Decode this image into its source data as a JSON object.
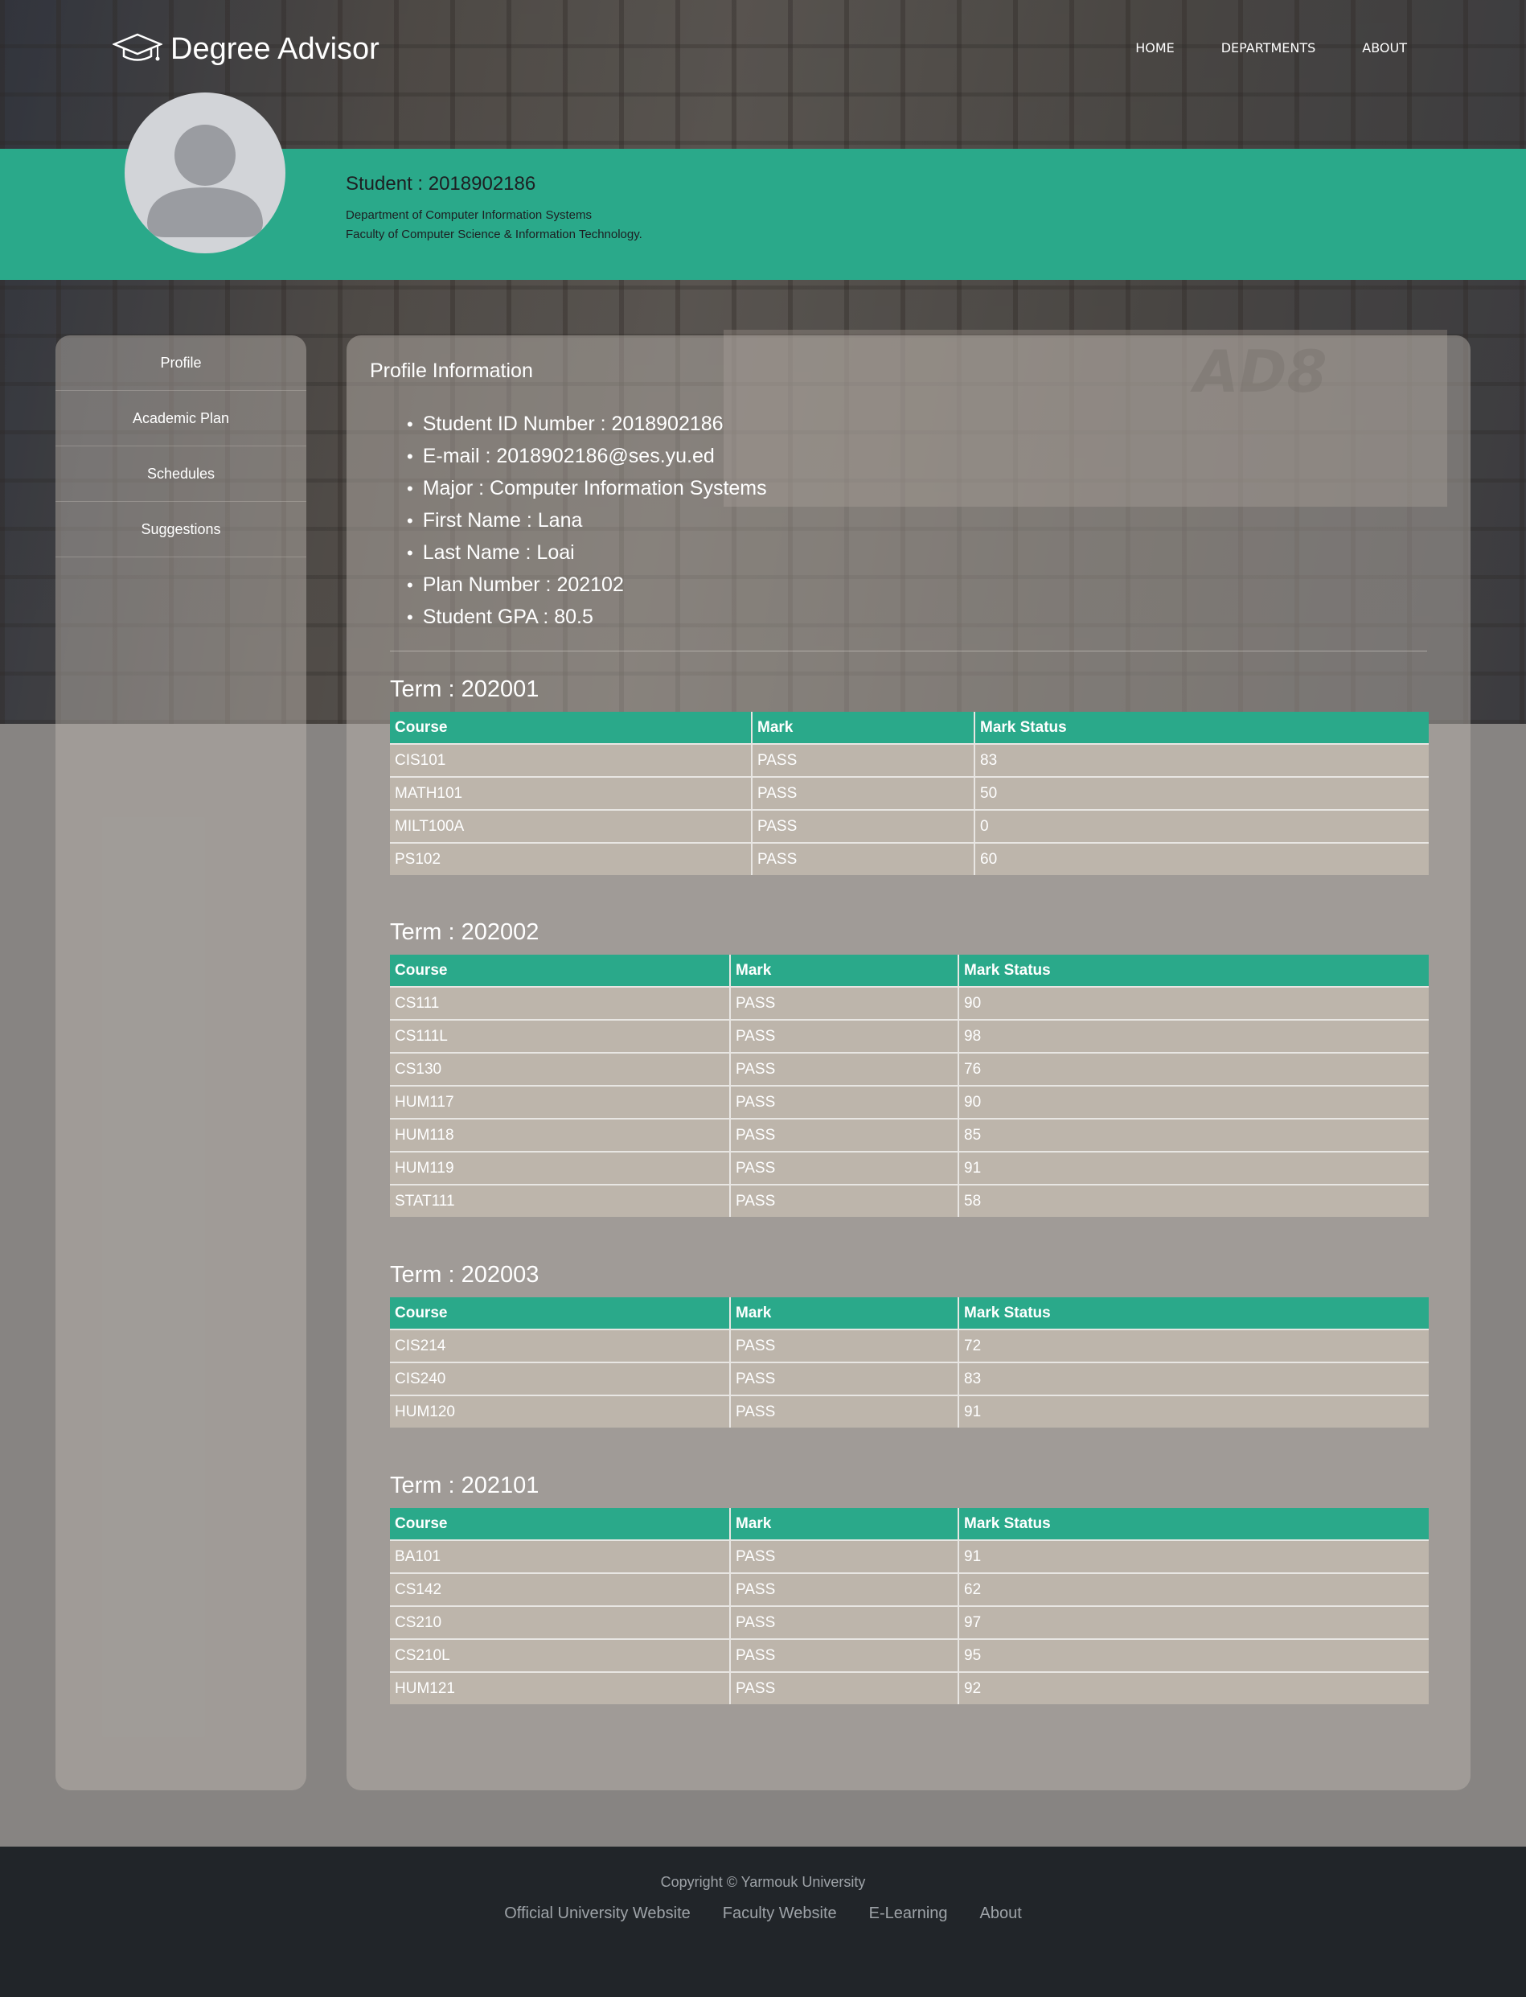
{
  "nav": {
    "brand": "Degree Advisor",
    "brand_icon": "graduation-cap-icon",
    "links": [
      "HOME",
      "DEPARTMENTS",
      "ABOUT"
    ]
  },
  "student": {
    "title": "Student : 2018902186",
    "department": "Department of Computer Information Systems",
    "faculty": "Faculty of Computer Science & Information Technology."
  },
  "sidebar": {
    "items": [
      "Profile",
      "Academic Plan",
      "Schedules",
      "Suggestions"
    ]
  },
  "profile": {
    "heading": "Profile Information",
    "items": [
      "Student ID Number : 2018902186",
      "E-mail : 2018902186@ses.yu.ed",
      "Major : Computer Information Systems",
      "First Name : Lana",
      "Last Name : Loai",
      "Plan Number : 202102",
      "Student GPA : 80.5"
    ]
  },
  "table_headers": [
    "Course",
    "Mark",
    "Mark Status"
  ],
  "terms": [
    {
      "title": "Term : 202001",
      "rows": [
        [
          "CIS101",
          "PASS",
          "83"
        ],
        [
          "MATH101",
          "PASS",
          "50"
        ],
        [
          "MILT100A",
          "PASS",
          "0"
        ],
        [
          "PS102",
          "PASS",
          "60"
        ]
      ]
    },
    {
      "title": "Term : 202002",
      "rows": [
        [
          "CS111",
          "PASS",
          "90"
        ],
        [
          "CS111L",
          "PASS",
          "98"
        ],
        [
          "CS130",
          "PASS",
          "76"
        ],
        [
          "HUM117",
          "PASS",
          "90"
        ],
        [
          "HUM118",
          "PASS",
          "85"
        ],
        [
          "HUM119",
          "PASS",
          "91"
        ],
        [
          "STAT111",
          "PASS",
          "58"
        ]
      ]
    },
    {
      "title": "Term : 202003",
      "rows": [
        [
          "CIS214",
          "PASS",
          "72"
        ],
        [
          "CIS240",
          "PASS",
          "83"
        ],
        [
          "HUM120",
          "PASS",
          "91"
        ]
      ]
    },
    {
      "title": "Term : 202101",
      "rows": [
        [
          "BA101",
          "PASS",
          "91"
        ],
        [
          "CS142",
          "PASS",
          "62"
        ],
        [
          "CS210",
          "PASS",
          "97"
        ],
        [
          "CS210L",
          "PASS",
          "95"
        ],
        [
          "HUM121",
          "PASS",
          "92"
        ]
      ]
    }
  ],
  "footer": {
    "copyright": "Copyright © Yarmouk University",
    "links": [
      "Official University Website",
      "Faculty Website",
      "E-Learning",
      "About"
    ]
  },
  "colors": {
    "accent": "#2aa98a",
    "footer_bg": "#212529",
    "row_bg": "#bdb5ab"
  }
}
